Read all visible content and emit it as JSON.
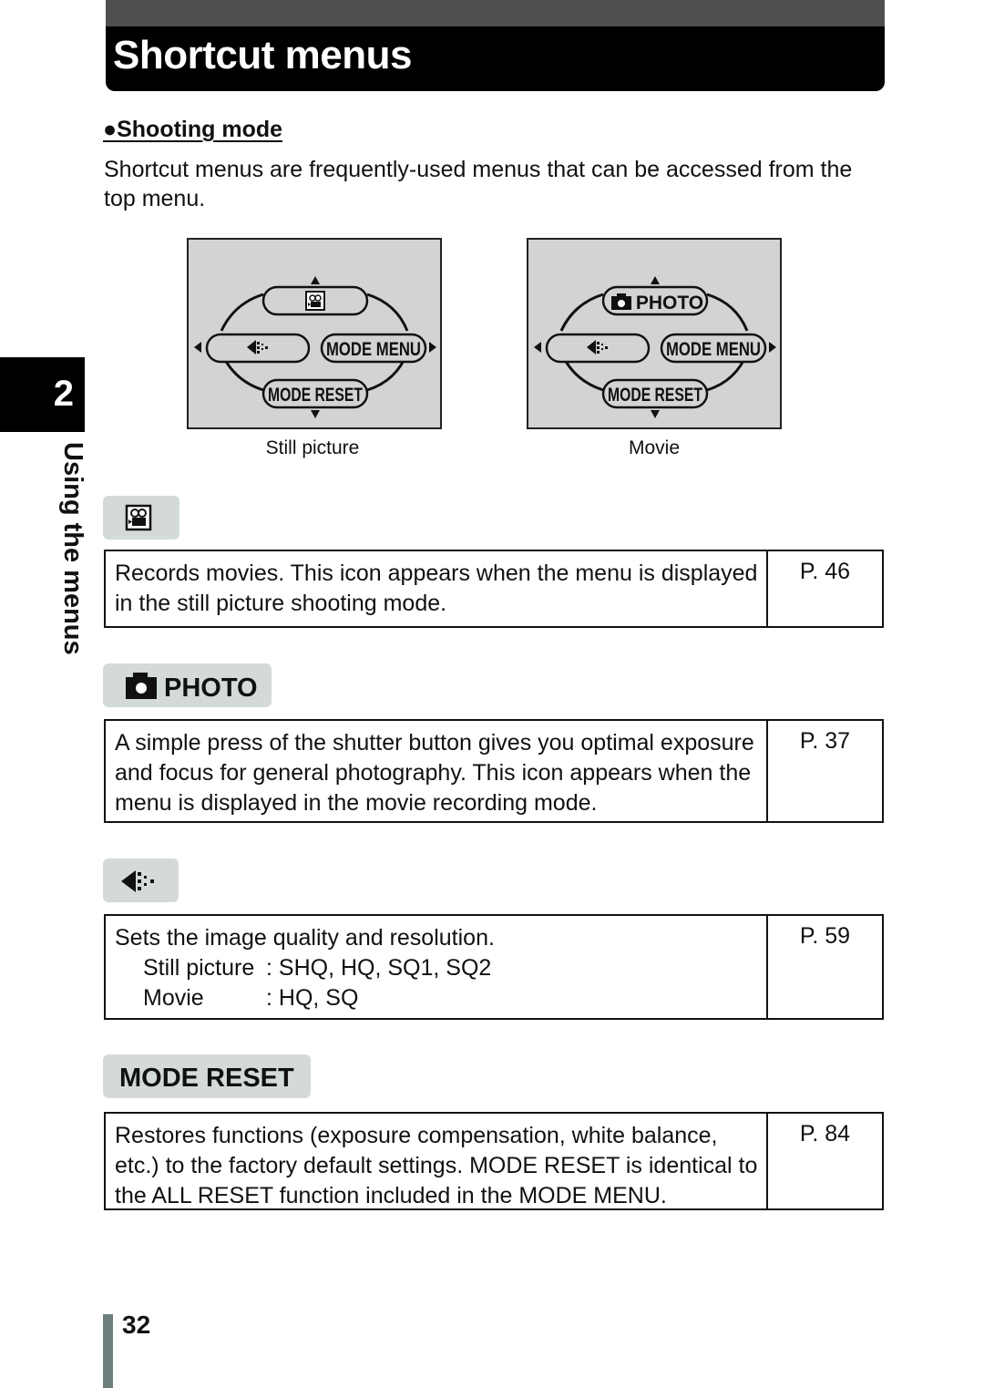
{
  "page_title": "Shortcut menus",
  "section_heading": "●Shooting mode",
  "intro_text": "Shortcut menus are frequently-used menus that can be accessed from the top menu.",
  "chapter": {
    "number": "2",
    "label": "Using the menus"
  },
  "screens": [
    {
      "caption": "Still picture",
      "top_icon": "movie-icon",
      "top_label": "",
      "left_icon": "image-quality-icon",
      "right_label": "MODE MENU",
      "bottom_label": "MODE RESET"
    },
    {
      "caption": "Movie",
      "top_icon": "camera-icon",
      "top_label": "PHOTO",
      "left_icon": "image-quality-icon",
      "right_label": "MODE MENU",
      "bottom_label": "MODE RESET"
    }
  ],
  "items": [
    {
      "tag_icon": "movie-icon",
      "tag_label": "",
      "description": "Records movies. This icon appears when the menu is displayed in the still picture shooting mode.",
      "page_ref": "P. 46"
    },
    {
      "tag_icon": "camera-icon",
      "tag_label": "PHOTO",
      "description": "A simple press of the shutter button gives you optimal exposure and focus for general photography. This icon appears when the menu is displayed in the movie recording mode.",
      "page_ref": "P. 37"
    },
    {
      "tag_icon": "image-quality-icon",
      "tag_label": "",
      "description": "Sets the image quality and resolution.",
      "sub_rows": [
        {
          "label": "Still picture",
          "value": ": SHQ, HQ, SQ1, SQ2"
        },
        {
          "label": "Movie",
          "value": ": HQ, SQ"
        }
      ],
      "page_ref": "P. 59"
    },
    {
      "tag_icon": "",
      "tag_label": "MODE RESET",
      "description": "Restores functions (exposure compensation, white balance, etc.) to the factory default settings. MODE RESET is identical to the ALL RESET function included in the MODE MENU.",
      "page_ref": "P. 84"
    }
  ],
  "page_number": "32"
}
